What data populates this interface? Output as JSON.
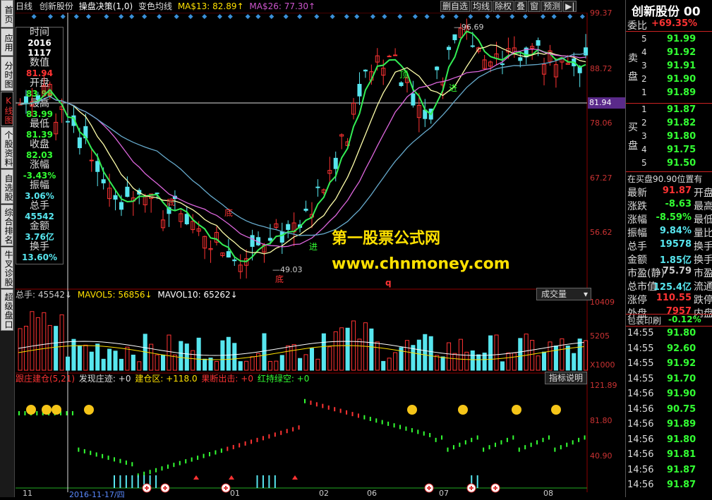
{
  "colors": {
    "up": "#ff3333",
    "down": "#33ff33",
    "cyan": "#57e6ef",
    "yellow": "#ffe100",
    "purple": "#cc55cc",
    "bg": "#000000"
  },
  "nav": [
    "首页",
    "应用",
    "分时图",
    "K线图",
    "个股资料",
    "自选股",
    "综合排名",
    "牛叉诊股",
    "超级盘口"
  ],
  "topbar": {
    "period": "日线",
    "stock": "创新股份",
    "strategy": "操盘决策(1,0)",
    "indicator": "变色均线",
    "ma13_label": "MA$13: 82.89↑",
    "ma26_label": "MA$26: 77.30↑"
  },
  "top_buttons": [
    "删自选",
    "均线",
    "除权",
    "叠",
    "窗",
    "预测"
  ],
  "info": [
    {
      "label": "时间",
      "value": "2016\n1117",
      "color": "#ffffff"
    },
    {
      "label": "数值",
      "value": "81.94",
      "color": "#ff3333"
    },
    {
      "label": "开盘",
      "value": "83.98",
      "color": "#33ff33"
    },
    {
      "label": "最高",
      "value": "83.99",
      "color": "#33ff33"
    },
    {
      "label": "最低",
      "value": "81.39",
      "color": "#33ff33"
    },
    {
      "label": "收盘",
      "value": "82.03",
      "color": "#33ff33"
    },
    {
      "label": "涨幅",
      "value": "-3.43%",
      "color": "#33ff33"
    },
    {
      "label": "振幅",
      "value": "3.06%",
      "color": "#57e6ef"
    },
    {
      "label": "总手",
      "value": "45542",
      "color": "#57e6ef"
    },
    {
      "label": "金额",
      "value": "3.76亿",
      "color": "#57e6ef"
    },
    {
      "label": "换手",
      "value": "13.60%",
      "color": "#57e6ef"
    }
  ],
  "price_axis": [
    "99.37",
    "88.72",
    "81.94",
    "78.06",
    "67.27",
    "56.62"
  ],
  "price_annotations": {
    "high": "96.69",
    "low": "49.03",
    "bottom": "底",
    "enter": "进",
    "top": "顶"
  },
  "watermark": {
    "line1": "第一股票公式网",
    "line2": "www.chnmoney.com"
  },
  "q_marker": "q",
  "vol": {
    "label": "总手: 45542↓",
    "mavol5": "MAVOL5: 56856↓",
    "mavol10": "MAVOL10: 65262↓",
    "dropdown": "成交量",
    "axis": [
      "10409",
      "5205",
      "X1000"
    ]
  },
  "ind": {
    "name": "跟庄建仓(5,21)",
    "f1": "发现庄迹: +0",
    "f2": "建仓区: +118.0",
    "f3": "果断出击: +0",
    "f4": "红持绿空: +0",
    "button": "指标说明",
    "axis": [
      "121.89",
      "81.80",
      "40.90"
    ]
  },
  "date_axis": [
    "11",
    "2016-11-17/四",
    "01",
    "02",
    "06",
    "07",
    "08"
  ],
  "right": {
    "title": "创新股份 00",
    "weibi_label": "委比",
    "weibi": "+69.35%",
    "sell_side": "卖盘",
    "buy_side": "买盘",
    "sells": [
      {
        "n": "5",
        "p": "91.99"
      },
      {
        "n": "4",
        "p": "91.92"
      },
      {
        "n": "3",
        "p": "91.91"
      },
      {
        "n": "2",
        "p": "91.90"
      },
      {
        "n": "1",
        "p": "91.89"
      }
    ],
    "buys": [
      {
        "n": "1",
        "p": "91.87"
      },
      {
        "n": "2",
        "p": "91.82"
      },
      {
        "n": "3",
        "p": "91.80"
      },
      {
        "n": "4",
        "p": "91.75"
      },
      {
        "n": "5",
        "p": "91.50"
      }
    ],
    "zaimai": "在买盘90.90位置有",
    "stats": [
      {
        "l": "最新",
        "v": "91.87",
        "c": "#ff3333",
        "r": "开盘"
      },
      {
        "l": "涨跌",
        "v": "-8.63",
        "c": "#33ff33",
        "r": "最高"
      },
      {
        "l": "涨幅",
        "v": "-8.59%",
        "c": "#33ff33",
        "r": "最低"
      },
      {
        "l": "振幅",
        "v": "9.84%",
        "c": "#57e6ef",
        "r": "量比"
      },
      {
        "l": "总手",
        "v": "19578",
        "c": "#57e6ef",
        "r": "换手"
      },
      {
        "l": "金额",
        "v": "1.85亿",
        "c": "#57e6ef",
        "r": "换手"
      },
      {
        "l": "市盈(静)",
        "v": "75.79",
        "c": "#cccccc",
        "r": "市盈"
      },
      {
        "l": "总市值",
        "v": "125.4亿",
        "c": "#57e6ef",
        "r": "流通"
      },
      {
        "l": "涨停",
        "v": "110.55",
        "c": "#ff3333",
        "r": "跌停"
      },
      {
        "l": "外盘",
        "v": "7957",
        "c": "#ff3333",
        "r": "内盘"
      }
    ],
    "tick_header": "包装印刷",
    "tick_change": "-0.12%",
    "ticks": [
      {
        "t": "14:55",
        "p": "91.80",
        "c": "#33ff33"
      },
      {
        "t": "14:55",
        "p": "92.60",
        "c": "#33ff33"
      },
      {
        "t": "14:55",
        "p": "91.92",
        "c": "#33ff33"
      },
      {
        "t": "14:55",
        "p": "91.70",
        "c": "#33ff33"
      },
      {
        "t": "14:56",
        "p": "91.90",
        "c": "#33ff33"
      },
      {
        "t": "14:56",
        "p": "90.75",
        "c": "#33ff33"
      },
      {
        "t": "14:56",
        "p": "91.89",
        "c": "#33ff33"
      },
      {
        "t": "14:56",
        "p": "91.80",
        "c": "#33ff33"
      },
      {
        "t": "14:56",
        "p": "91.81",
        "c": "#33ff33"
      },
      {
        "t": "14:56",
        "p": "91.87",
        "c": "#33ff33"
      },
      {
        "t": "14:56",
        "p": "91.87",
        "c": "#33ff33"
      }
    ]
  }
}
